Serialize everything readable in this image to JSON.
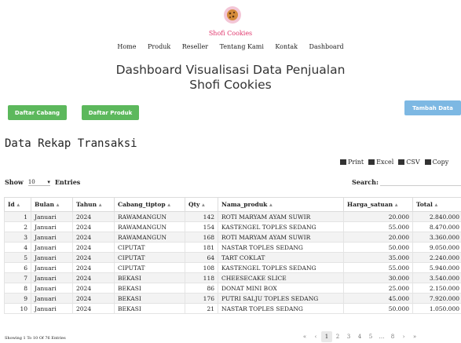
{
  "brand": {
    "name": "Shofi Cookies"
  },
  "nav": {
    "items": [
      "Home",
      "Produk",
      "Reseller",
      "Tentang Kami",
      "Kontak",
      "Dashboard"
    ]
  },
  "headline": {
    "line1": "Dashboard Visualisasi Data Penjualan",
    "line2": "Shofi Cookies"
  },
  "buttons": {
    "cabang": "Daftar Cabang",
    "produk": "Daftar Produk",
    "tambah": "Tambah Data"
  },
  "section": {
    "title": "Data Rekap Transaksi"
  },
  "exports": {
    "print": "Print",
    "excel": "Excel",
    "csv": "CSV",
    "copy": "Copy"
  },
  "controls": {
    "show_label": "Show",
    "page_length": "10",
    "entries_label": "Entries",
    "search_label": "Search:"
  },
  "table": {
    "headers": [
      "Id",
      "Bulan",
      "Tahun",
      "Cabang_tiptop",
      "Qty",
      "Nama_produk",
      "Harga_satuan",
      "Total"
    ],
    "rows": [
      [
        "1",
        "Januari",
        "2024",
        "RAWAMANGUN",
        "142",
        "ROTI MARYAM AYAM SUWIR",
        "20.000",
        "2.840.000"
      ],
      [
        "2",
        "Januari",
        "2024",
        "RAWAMANGUN",
        "154",
        "KASTENGEL TOPLES SEDANG",
        "55.000",
        "8.470.000"
      ],
      [
        "3",
        "Januari",
        "2024",
        "RAWAMANGUN",
        "168",
        "ROTI MARYAM AYAM SUWIR",
        "20.000",
        "3.360.000"
      ],
      [
        "4",
        "Januari",
        "2024",
        "CIPUTAT",
        "181",
        "NASTAR TOPLES SEDANG",
        "50.000",
        "9.050.000"
      ],
      [
        "5",
        "Januari",
        "2024",
        "CIPUTAT",
        "64",
        "TART COKLAT",
        "35.000",
        "2.240.000"
      ],
      [
        "6",
        "Januari",
        "2024",
        "CIPUTAT",
        "108",
        "KASTENGEL TOPLES SEDANG",
        "55.000",
        "5.940.000"
      ],
      [
        "7",
        "Januari",
        "2024",
        "BEKASI",
        "118",
        "CHEESECAKE SLICE",
        "30.000",
        "3.540.000"
      ],
      [
        "8",
        "Januari",
        "2024",
        "BEKASI",
        "86",
        "DONAT MINI BOX",
        "25.000",
        "2.150.000"
      ],
      [
        "9",
        "Januari",
        "2024",
        "BEKASI",
        "176",
        "PUTRI SALJU TOPLES SEDANG",
        "45.000",
        "7.920.000"
      ],
      [
        "10",
        "Januari",
        "2024",
        "BEKASI",
        "21",
        "NASTAR TOPLES SEDANG",
        "50.000",
        "1.050.000"
      ]
    ]
  },
  "footer": {
    "info": "Showing 1 To 10 Of 76 Entries"
  },
  "pagination": {
    "first": "«",
    "prev": "‹",
    "pages": [
      "1",
      "2",
      "3",
      "4",
      "5",
      "…",
      "8"
    ],
    "next": "›",
    "last": "»",
    "active": "1"
  }
}
